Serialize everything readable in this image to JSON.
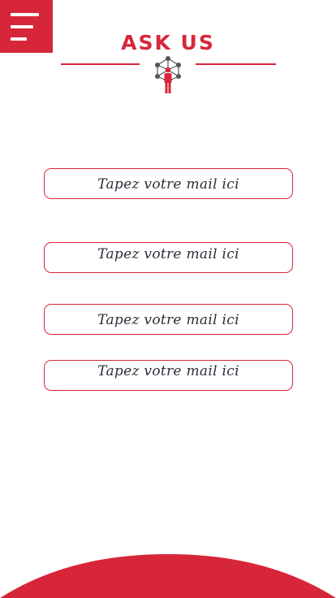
{
  "header": {
    "title": "ASK US",
    "menu_icon": "hamburger-menu-icon",
    "logo_icon": "network-person-icon"
  },
  "form": {
    "fields": [
      {
        "placeholder": "Tapez votre mail ici"
      },
      {
        "placeholder": "Tapez votre mail ici"
      },
      {
        "placeholder": "Tapez votre mail ici"
      },
      {
        "placeholder": "Tapez votre mail ici"
      }
    ]
  },
  "colors": {
    "accent": "#d7263a",
    "text": "#2d2d3a",
    "icon_gray": "#555555",
    "background": "#ffffff"
  }
}
